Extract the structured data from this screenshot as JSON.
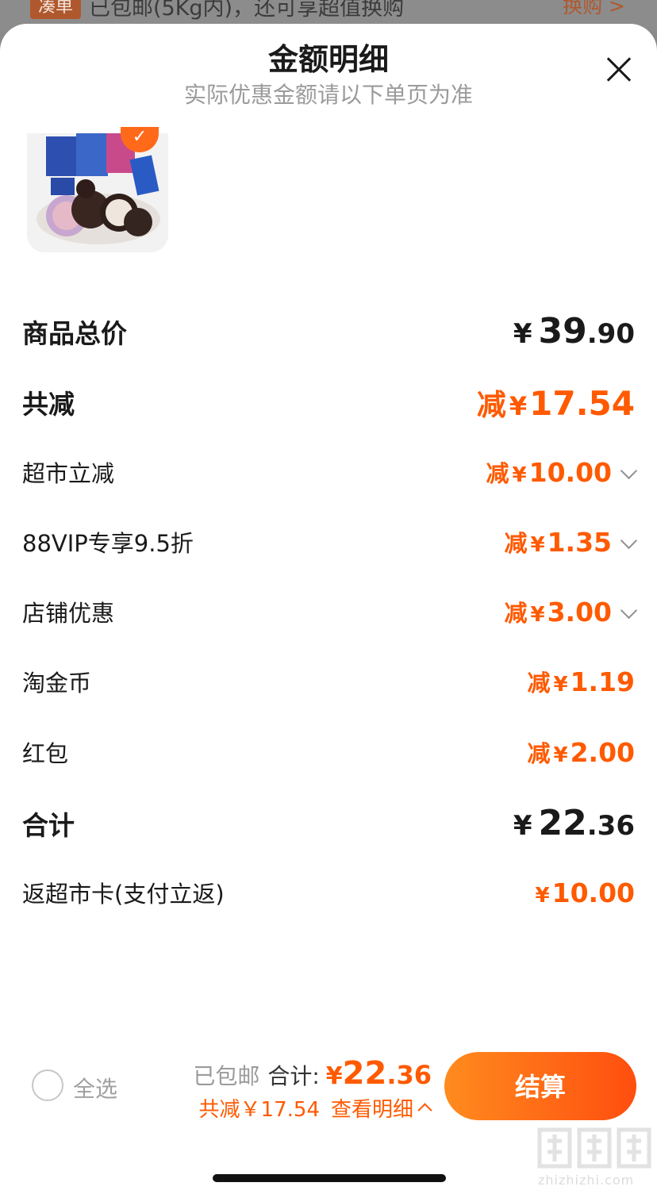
{
  "background_banner": {
    "tag": "凑单",
    "text": "已包邮(5Kg内)，还可享超值换购",
    "link": "换购 >"
  },
  "sheet": {
    "title": "金额明细",
    "subtitle": "实际优惠金额请以下单页为准"
  },
  "rows": {
    "total": {
      "label": "商品总价",
      "cur": "¥",
      "int": "39",
      "dec": ".90"
    },
    "saved": {
      "label": "共减",
      "prefix": "减",
      "cur": "¥",
      "value": "17.54"
    },
    "items": [
      {
        "label": "超市立减",
        "prefix": "减",
        "cur": "¥",
        "value": "10.00"
      },
      {
        "label": "88VIP专享9.5折",
        "prefix": "减",
        "cur": "¥",
        "value": "1.35"
      },
      {
        "label": "店铺优惠",
        "prefix": "减",
        "cur": "¥",
        "value": "3.00"
      },
      {
        "label": "淘金币",
        "prefix": "减",
        "cur": "¥",
        "value": "1.19"
      },
      {
        "label": "红包",
        "prefix": "减",
        "cur": "¥",
        "value": "2.00"
      }
    ],
    "sum": {
      "label": "合计",
      "cur": "¥",
      "int": "22",
      "dec": ".36"
    },
    "rebate": {
      "label": "返超市卡(支付立返)",
      "cur": "¥",
      "value": "10.00"
    }
  },
  "bottom_bar": {
    "select_all": "全选",
    "shipping": "已包邮",
    "total_label": "合计:",
    "total_cur": "¥",
    "total_int": "22",
    "total_dec": ".36",
    "saved_text": "共减￥17.54",
    "view_detail": "查看明细",
    "pay_button": "结算"
  },
  "watermark": {
    "site": "zhizhizhi.com"
  },
  "colors": {
    "accent": "#ff5a00",
    "pay_gradient_start": "#ff8b1e",
    "pay_gradient_end": "#ff4e0f"
  }
}
